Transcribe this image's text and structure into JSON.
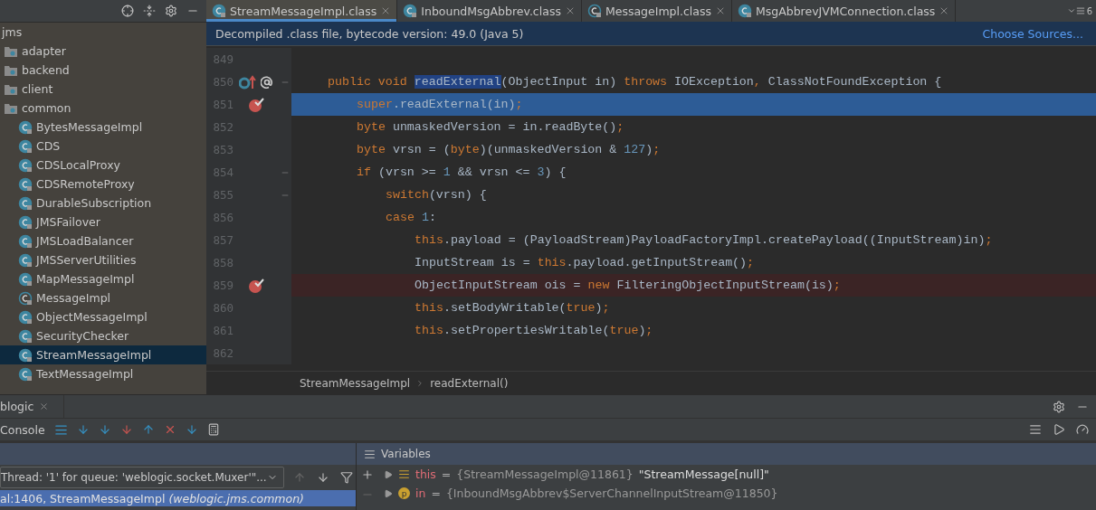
{
  "project": {
    "root": "jms",
    "items": [
      {
        "label": "adapter",
        "kind": "package",
        "selected": false
      },
      {
        "label": "backend",
        "kind": "package",
        "selected": false
      },
      {
        "label": "client",
        "kind": "package",
        "selected": false
      },
      {
        "label": "common",
        "kind": "package",
        "selected": false,
        "children": [
          {
            "label": "BytesMessageImpl",
            "kind": "class",
            "selected": false
          },
          {
            "label": "CDS",
            "kind": "class",
            "selected": false
          },
          {
            "label": "CDSLocalProxy",
            "kind": "class",
            "selected": false
          },
          {
            "label": "CDSRemoteProxy",
            "kind": "class",
            "selected": false
          },
          {
            "label": "DurableSubscription",
            "kind": "class",
            "selected": false
          },
          {
            "label": "JMSFailover",
            "kind": "class",
            "selected": false
          },
          {
            "label": "JMSLoadBalancer",
            "kind": "class",
            "selected": false
          },
          {
            "label": "JMSServerUtilities",
            "kind": "class",
            "selected": false
          },
          {
            "label": "MapMessageImpl",
            "kind": "class",
            "selected": false
          },
          {
            "label": "MessageImpl",
            "kind": "abstract",
            "selected": false
          },
          {
            "label": "ObjectMessageImpl",
            "kind": "class",
            "selected": false
          },
          {
            "label": "SecurityChecker",
            "kind": "class",
            "selected": false
          },
          {
            "label": "StreamMessageImpl",
            "kind": "class",
            "selected": true
          },
          {
            "label": "TextMessageImpl",
            "kind": "class",
            "selected": false
          }
        ]
      }
    ]
  },
  "tabs": [
    {
      "label": "StreamMessageImpl.class",
      "selected": true,
      "kind": "class"
    },
    {
      "label": "InboundMsgAbbrev.class",
      "selected": false,
      "kind": "class"
    },
    {
      "label": "MessageImpl.class",
      "selected": false,
      "kind": "abstract"
    },
    {
      "label": "MsgAbbrevJVMConnection.class",
      "selected": false,
      "kind": "class"
    }
  ],
  "tab_count": "6",
  "banner": {
    "text": "Decompiled .class file, bytecode version: 49.0 (Java 5)",
    "link": "Choose Sources..."
  },
  "code": [
    {
      "number": "849",
      "current": false,
      "breakpoint": false,
      "fold": false,
      "markers": false
    },
    {
      "number": "850",
      "current": false,
      "breakpoint": false,
      "fold": true,
      "markers": true,
      "tokens": [
        {
          "t": "public void ",
          "kind": "keyword"
        },
        {
          "t": "readExternal",
          "kind": "selection"
        },
        {
          "t": "(ObjectInput in) ",
          "kind": "plain"
        },
        {
          "t": "throws ",
          "kind": "keyword"
        },
        {
          "t": "IOException",
          "kind": "plain"
        },
        {
          "t": ", ",
          "kind": "keyword"
        },
        {
          "t": "ClassNotFoundException {",
          "kind": "plain"
        }
      ],
      "children": [
        {
          "number": "851",
          "current": true,
          "breakpoint": true,
          "fold": false,
          "markers": false,
          "tokens": [
            {
              "t": "super",
              "kind": "keyword"
            },
            {
              "t": ".readExternal(in)",
              "kind": "plain"
            },
            {
              "t": ";",
              "kind": "keyword"
            }
          ]
        },
        {
          "number": "852",
          "current": false,
          "breakpoint": false,
          "fold": false,
          "markers": false,
          "tokens": [
            {
              "t": "byte ",
              "kind": "keyword"
            },
            {
              "t": "unmaskedVersion = in.readByte()",
              "kind": "plain"
            },
            {
              "t": ";",
              "kind": "keyword"
            }
          ]
        },
        {
          "number": "853",
          "current": false,
          "breakpoint": false,
          "fold": false,
          "markers": false,
          "tokens": [
            {
              "t": "byte ",
              "kind": "keyword"
            },
            {
              "t": "vrsn = (",
              "kind": "plain"
            },
            {
              "t": "byte",
              "kind": "keyword"
            },
            {
              "t": ")(unmaskedVersion & ",
              "kind": "plain"
            },
            {
              "t": "127",
              "kind": "number"
            },
            {
              "t": ")",
              "kind": "plain"
            },
            {
              "t": ";",
              "kind": "keyword"
            }
          ]
        },
        {
          "number": "854",
          "current": false,
          "breakpoint": false,
          "fold": true,
          "markers": false,
          "tokens": [
            {
              "t": "if ",
              "kind": "keyword"
            },
            {
              "t": "(vrsn >= ",
              "kind": "plain"
            },
            {
              "t": "1",
              "kind": "number"
            },
            {
              "t": " && vrsn <= ",
              "kind": "plain"
            },
            {
              "t": "3",
              "kind": "number"
            },
            {
              "t": ") {",
              "kind": "plain"
            }
          ],
          "children": [
            {
              "number": "855",
              "current": false,
              "breakpoint": false,
              "fold": true,
              "markers": false,
              "tokens": [
                {
                  "t": "switch",
                  "kind": "keyword"
                },
                {
                  "t": "(vrsn) {",
                  "kind": "plain"
                }
              ]
            },
            {
              "number": "856",
              "current": false,
              "breakpoint": false,
              "fold": false,
              "markers": false,
              "tokens": [
                {
                  "t": "case ",
                  "kind": "keyword"
                },
                {
                  "t": "1",
                  "kind": "number"
                },
                {
                  "t": ":",
                  "kind": "plain"
                }
              ],
              "children": [
                {
                  "number": "857",
                  "current": false,
                  "breakpoint": false,
                  "fold": false,
                  "markers": false,
                  "tokens": [
                    {
                      "t": "this",
                      "kind": "keyword"
                    },
                    {
                      "t": ".payload = (PayloadStream)PayloadFactoryImpl.createPayload((InputStream)in)",
                      "kind": "plain"
                    },
                    {
                      "t": ";",
                      "kind": "keyword"
                    }
                  ]
                },
                {
                  "number": "858",
                  "current": false,
                  "breakpoint": false,
                  "fold": false,
                  "markers": false,
                  "tokens": [
                    {
                      "t": "InputStream is = ",
                      "kind": "plain"
                    },
                    {
                      "t": "this",
                      "kind": "keyword"
                    },
                    {
                      "t": ".payload.getInputStream()",
                      "kind": "plain"
                    },
                    {
                      "t": ";",
                      "kind": "keyword"
                    }
                  ]
                },
                {
                  "number": "859",
                  "current": false,
                  "breakpoint": true,
                  "fold": false,
                  "markers": false,
                  "tokens": [
                    {
                      "t": "ObjectInputStream ois = ",
                      "kind": "plain"
                    },
                    {
                      "t": "new ",
                      "kind": "keyword"
                    },
                    {
                      "t": "FilteringObjectInputStream(is)",
                      "kind": "plain"
                    },
                    {
                      "t": ";",
                      "kind": "keyword"
                    }
                  ]
                },
                {
                  "number": "860",
                  "current": false,
                  "breakpoint": false,
                  "fold": false,
                  "markers": false,
                  "tokens": [
                    {
                      "t": "this",
                      "kind": "keyword"
                    },
                    {
                      "t": ".setBodyWritable(",
                      "kind": "plain"
                    },
                    {
                      "t": "true",
                      "kind": "keyword"
                    },
                    {
                      "t": ")",
                      "kind": "plain"
                    },
                    {
                      "t": ";",
                      "kind": "keyword"
                    }
                  ]
                },
                {
                  "number": "861",
                  "current": false,
                  "breakpoint": false,
                  "fold": false,
                  "markers": false,
                  "tokens": [
                    {
                      "t": "this",
                      "kind": "keyword"
                    },
                    {
                      "t": ".setPropertiesWritable(",
                      "kind": "plain"
                    },
                    {
                      "t": "true",
                      "kind": "keyword"
                    },
                    {
                      "t": ")",
                      "kind": "plain"
                    },
                    {
                      "t": ";",
                      "kind": "keyword"
                    }
                  ]
                }
              ]
            }
          ]
        }
      ]
    },
    {
      "number": "862",
      "current": false,
      "breakpoint": false,
      "fold": false,
      "markers": false
    }
  ],
  "breadcrumb": [
    "StreamMessageImpl",
    "readExternal()"
  ],
  "debug": {
    "tab": "blogic",
    "console": "Console",
    "thread": "Thread: '1' for queue: 'weblogic.socket.Muxer'\"...",
    "frame": {
      "text": "al:1406, StreamMessageImpl",
      "package": "(weblogic.jms.common)",
      "selected": true
    },
    "variables_title": "Variables",
    "variables": [
      {
        "name": "this",
        "kind": "object",
        "operator": "=",
        "ref": "{StreamMessageImpl@11861}",
        "value": "\"StreamMessage[null]\""
      },
      {
        "name": "in",
        "kind": "field",
        "badge": "p",
        "operator": "=",
        "ref": "{InboundMsgAbbrev$ServerChannelInputStream@11850}"
      }
    ]
  }
}
